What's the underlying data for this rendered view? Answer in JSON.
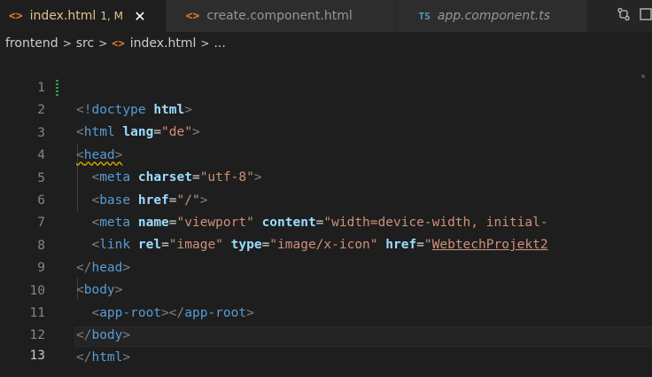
{
  "tabs": [
    {
      "icon": "html-file-icon",
      "label": "index.html",
      "status": "1, M",
      "active": true,
      "close": "✕"
    },
    {
      "icon": "html-file-icon",
      "label": "create.component.html",
      "active": false
    },
    {
      "icon": "ts-file-icon",
      "icon_text": "TS",
      "label": "app.component.ts",
      "active": false,
      "italic": true
    }
  ],
  "tab_actions": [
    "compare-changes-icon",
    "split-editor-icon"
  ],
  "breadcrumb": {
    "items": [
      "frontend",
      "src",
      "index.html",
      "..."
    ],
    "separator": ">"
  },
  "editor": {
    "current_line": 13,
    "line_numbers": [
      "1",
      "2",
      "3",
      "4",
      "5",
      "6",
      "7",
      "8",
      "9",
      "10",
      "11",
      "12",
      "13"
    ],
    "lines": [
      "<!doctype html>",
      "<html lang=\"de\">",
      "<head>",
      "  <meta charset=\"utf-8\">",
      "  <base href=\"/\">",
      "  <meta name=\"viewport\" content=\"width=device-width, initial-",
      "  <link rel=\"image\" type=\"image/x-icon\" href=\"WebtechProjekt2",
      "</head>",
      "<body>",
      "  <app-root></app-root>",
      "</body>",
      "</html>",
      ""
    ]
  },
  "colors": {
    "background": "#1e1e1e",
    "tag": "#569cd6",
    "attribute": "#9cdcfe",
    "string": "#ce9178",
    "punctuation": "#808080",
    "modified_tab": "#e2c08d",
    "html_icon": "#e37933",
    "ts_icon": "#519aba"
  }
}
